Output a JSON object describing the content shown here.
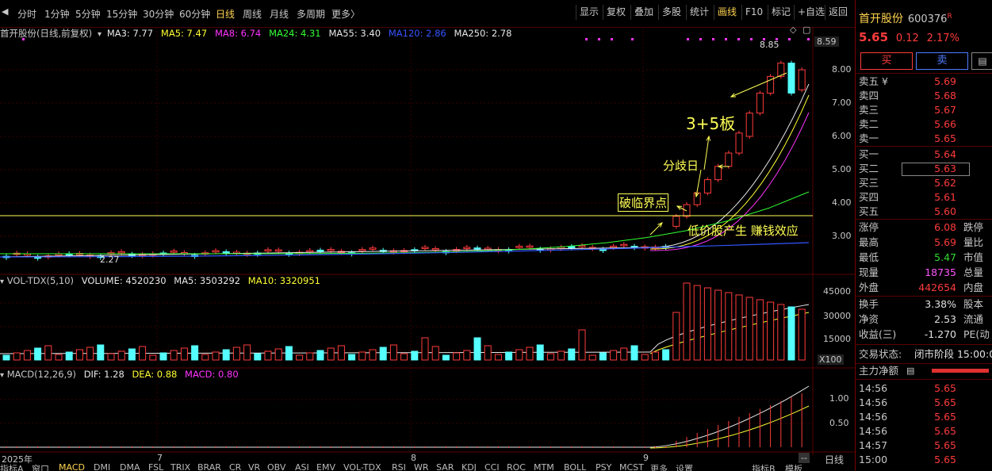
{
  "toolbar": {
    "periods": [
      "分时",
      "1分钟",
      "5分钟",
      "15分钟",
      "30分钟",
      "60分钟",
      "日线",
      "周线",
      "月线",
      "多周期",
      "更多〉"
    ],
    "active_period": "日线",
    "right_buttons": [
      "显示",
      "复权",
      "叠加",
      "多股",
      "统计",
      "画线",
      "F10",
      "标记",
      "+自选",
      "返回"
    ],
    "active_right": "画线"
  },
  "main_chart": {
    "title": "首开股份(日线,前复权)",
    "ma": [
      {
        "label": "MA3: 7.77",
        "color": "#e8e8e8"
      },
      {
        "label": "MA5: 7.47",
        "color": "#ffff33"
      },
      {
        "label": "MA8: 6.74",
        "color": "#ff33ff"
      },
      {
        "label": "MA24: 4.31",
        "color": "#33ff33"
      },
      {
        "label": "MA55: 3.40",
        "color": "#e8e8e8"
      },
      {
        "label": "MA120: 2.86",
        "color": "#3355ff"
      },
      {
        "label": "MA250: 2.78",
        "color": "#e8e8e8"
      }
    ],
    "price_axis": [
      "8.59",
      "8.00",
      "7.00",
      "6.00",
      "5.00",
      "4.00",
      "3.00"
    ],
    "high_label": "8.85",
    "low_label": "2.27",
    "annotations": [
      "3+5板",
      "分歧日",
      "破临界点",
      "低价股产生 赚钱效应"
    ]
  },
  "volume_chart": {
    "title": "VOL-TDX(5,10)",
    "volume": "VOLUME: 4520230",
    "ma5": "MA5: 3503292",
    "ma10": "MA10: 3320951",
    "axis": [
      "45000",
      "30000",
      "15000"
    ],
    "unit": "X100"
  },
  "macd_chart": {
    "title": "MACD(12,26,9)",
    "dif": "DIF: 1.28",
    "dea": "DEA: 0.88",
    "macd": "MACD: 0.80",
    "axis": [
      "1.00",
      "0.50"
    ]
  },
  "time_axis": {
    "labels": [
      "2025年",
      "7",
      "8",
      "9"
    ],
    "period_button": "日线",
    "scroll": "--"
  },
  "bottom_tabs": [
    "指标A",
    "窗口",
    "MACD",
    "DMI",
    "DMA",
    "FSL",
    "TRIX",
    "BRAR",
    "CR",
    "VR",
    "OBV",
    "ASI",
    "EMV",
    "VOL-TDX",
    "RSI",
    "WR",
    "SAR",
    "KDJ",
    "CCI",
    "ROC",
    "MTM",
    "BOLL",
    "PSY",
    "MCST",
    "更多",
    "设置",
    "指标B",
    "模板"
  ],
  "quote": {
    "name": "首开股份",
    "code": "600376",
    "tag": "R",
    "price": "5.65",
    "change": "0.12",
    "change_pct": "2.17%",
    "buy_btn": "买",
    "sell_btn": "卖",
    "asks": [
      {
        "label": "卖五 ¥",
        "price": "5.69"
      },
      {
        "label": "卖四",
        "price": "5.68"
      },
      {
        "label": "卖三",
        "price": "5.67"
      },
      {
        "label": "卖二",
        "price": "5.66"
      },
      {
        "label": "卖一",
        "price": "5.65"
      }
    ],
    "bids": [
      {
        "label": "买一",
        "price": "5.64"
      },
      {
        "label": "买二",
        "price": "5.63"
      },
      {
        "label": "买三",
        "price": "5.62"
      },
      {
        "label": "买四",
        "price": "5.61"
      },
      {
        "label": "买五",
        "price": "5.60"
      }
    ],
    "stats": [
      {
        "label": "涨停",
        "value": "6.08",
        "extra": "跌停",
        "color": "red"
      },
      {
        "label": "最高",
        "value": "5.69",
        "extra": "量比",
        "color": "red"
      },
      {
        "label": "最低",
        "value": "5.47",
        "extra": "市值",
        "color": "green"
      },
      {
        "label": "现量",
        "value": "18735",
        "extra": "总量",
        "color": "magenta"
      },
      {
        "label": "外盘",
        "value": "442654",
        "extra": "内盘",
        "color": "red"
      }
    ],
    "stats2": [
      {
        "label": "换手",
        "value": "3.38%",
        "extra": "股本"
      },
      {
        "label": "净资",
        "value": "2.53",
        "extra": "流通"
      },
      {
        "label": "收益(三)",
        "value": "-1.270",
        "extra": "PE(动"
      }
    ],
    "status_label": "交易状态:",
    "status_value": "闭市阶段 15:00:0",
    "net_label": "主力净额",
    "ticks": [
      {
        "time": "14:56",
        "price": "5.65"
      },
      {
        "time": "14:56",
        "price": "5.65"
      },
      {
        "time": "14:56",
        "price": "5.65"
      },
      {
        "time": "14:56",
        "price": "5.65"
      },
      {
        "time": "14:57",
        "price": "5.65"
      },
      {
        "time": "15:00",
        "price": "5.65"
      }
    ]
  },
  "colors": {
    "up": "#ff3b3b",
    "down": "#55ffff",
    "bg": "#000000",
    "accent": "#ffd34f"
  }
}
